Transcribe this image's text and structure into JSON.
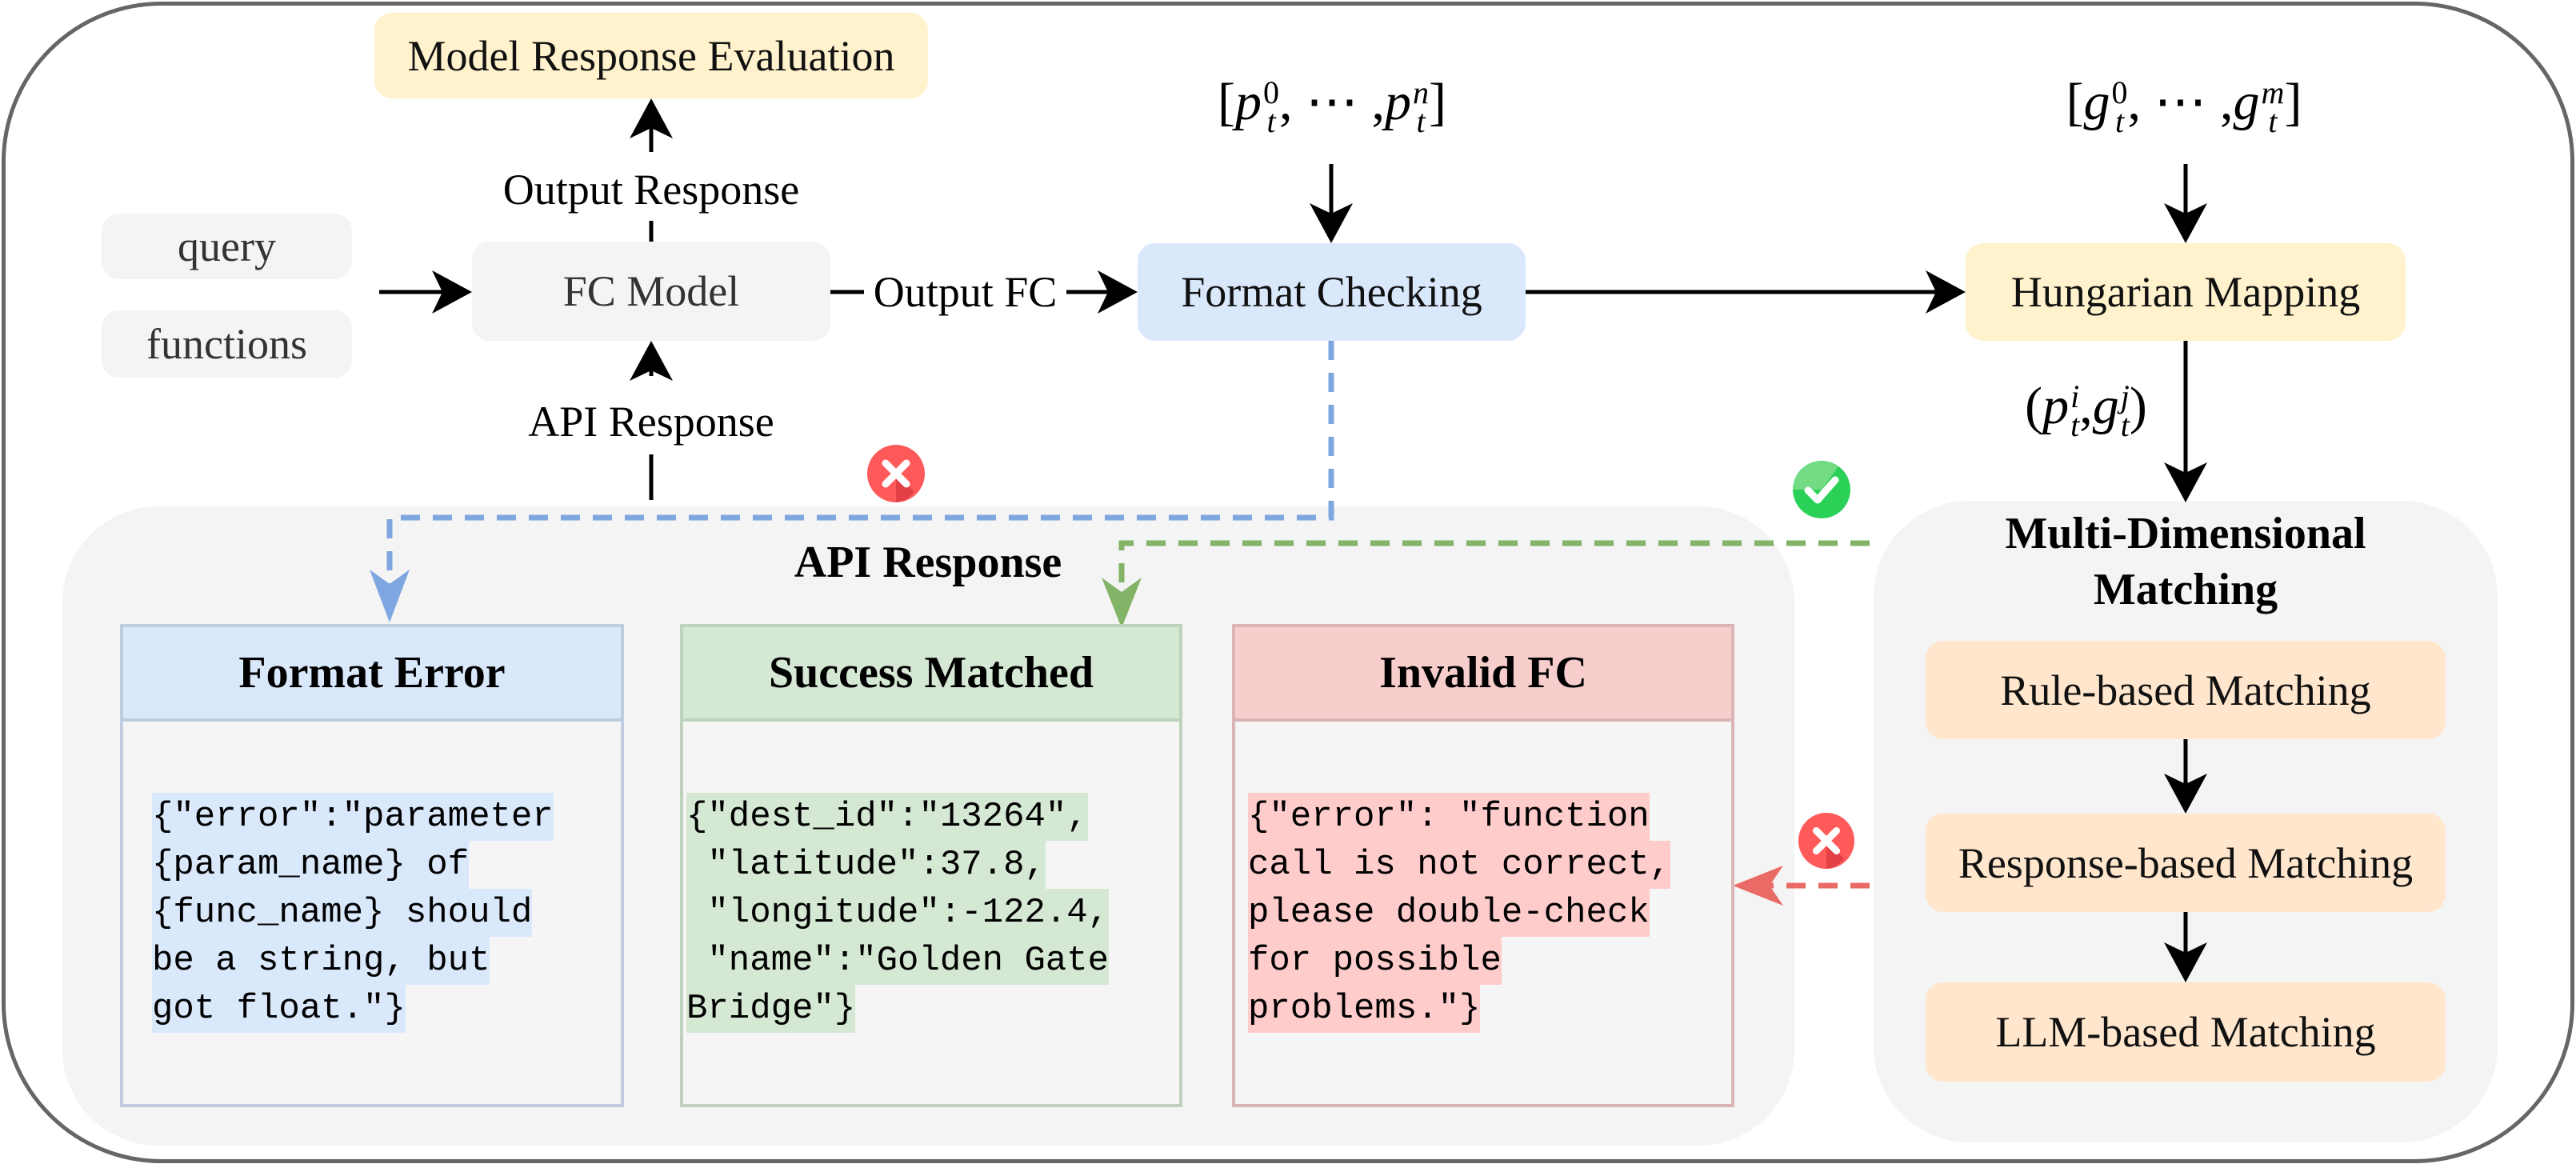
{
  "diagram": {
    "top": {
      "evaluation": "Model Response Evaluation",
      "output_response": "Output Response",
      "inputs": [
        "query",
        "functions"
      ],
      "fc_model": "FC Model",
      "api_response_label": "API Response",
      "output_fc": "Output FC",
      "format_checking": "Format Checking",
      "hungarian_mapping": "Hungarian Mapping",
      "pred_list": {
        "open": "[",
        "var": "p",
        "sub": "t",
        "first_sup": "0",
        "ellipsis": ", ⋯ ,",
        "last_sup": "n",
        "close": "]"
      },
      "gold_list": {
        "open": "[",
        "var": "g",
        "sub": "t",
        "first_sup": "0",
        "ellipsis": ", ⋯ ,",
        "last_sup": "m",
        "close": "]"
      },
      "pair": {
        "open": "(",
        "var1": "p",
        "sup1": "i",
        "sub": "t",
        "comma": ",",
        "var2": "g",
        "sup2": "j",
        "close": ")"
      }
    },
    "api_panel": {
      "title": "API Response",
      "cards": [
        {
          "title": "Format Error",
          "color": "#dae8fc",
          "lines": [
            "{\"error\":\"parameter",
            "{param_name} of",
            "{func_name} should",
            "be a string, but",
            "got float.\"}"
          ]
        },
        {
          "title": "Success Matched",
          "color": "#d5e8d4",
          "lines": [
            "{\"dest_id\":\"13264\",",
            " \"latitude\":37.8,",
            " \"longitude\":-122.4,",
            " \"name\":\"Golden Gate",
            "Bridge\"}"
          ]
        },
        {
          "title": "Invalid FC",
          "color": "#f8cecc",
          "lines": [
            "{\"error\": \"function",
            "call is not correct,",
            "please double-check",
            "for possible",
            "problems.\"}"
          ]
        }
      ]
    },
    "matching_panel": {
      "title_lines": [
        "Multi-Dimensional",
        "Matching"
      ],
      "steps": [
        "Rule-based Matching",
        "Response-based Matching",
        "LLM-based Matching"
      ]
    },
    "icons": {
      "fail_format": "cross-icon",
      "success": "check-icon",
      "fail_match": "cross-icon"
    },
    "colors": {
      "blue_flow": "#7ea6e0",
      "green_flow": "#82b366",
      "red_flow": "#ea6b66"
    }
  }
}
